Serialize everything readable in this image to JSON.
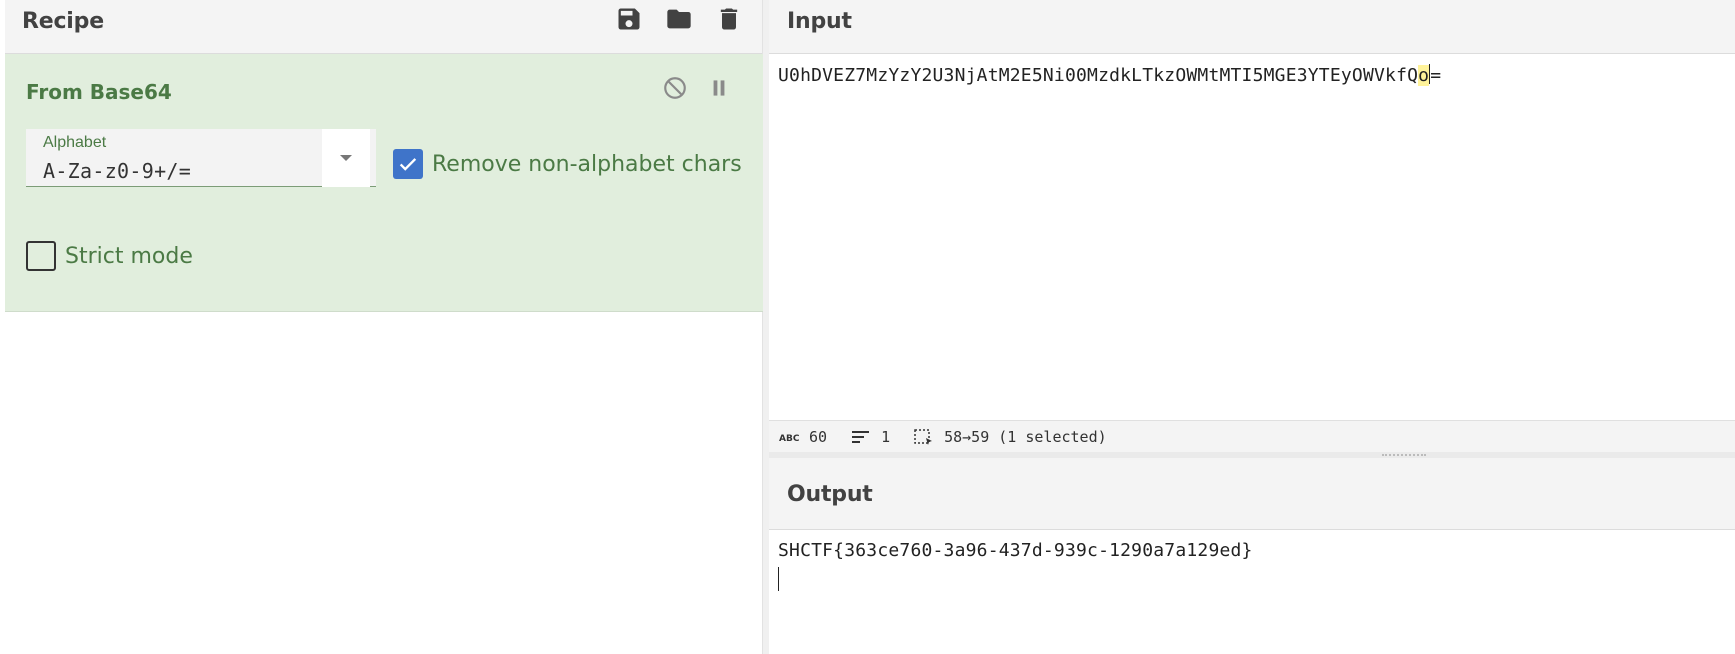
{
  "recipe": {
    "title": "Recipe",
    "icons": [
      "save-icon",
      "folder-open-icon",
      "trash-icon"
    ],
    "operation": {
      "name": "From Base64",
      "alphabet_label": "Alphabet",
      "alphabet_value": "A-Za-z0-9+/=",
      "remove_non_alphabet_label": "Remove non-alphabet chars",
      "remove_non_alphabet_checked": true,
      "strict_mode_label": "Strict mode",
      "strict_mode_checked": false,
      "controls": [
        "disable-icon",
        "pause-icon"
      ]
    },
    "colors": {
      "card_bg": "#e1eedd",
      "accent_green": "#4b7a45",
      "checkbox_blue": "#3f74c9"
    }
  },
  "input": {
    "title": "Input",
    "text_before": "U0hDVEZ7MzYzY2U3NjAtM2E5Ni00MzdkLTkzOWMtMTI5MGE3YTEyOWVkfQ",
    "text_selected": "o",
    "text_after": "=",
    "status": {
      "length": "60",
      "lines": "1",
      "selection": "58→59 (1 selected)"
    }
  },
  "output": {
    "title": "Output",
    "text": "SHCTF{363ce760-3a96-437d-939c-1290a7a129ed}"
  }
}
